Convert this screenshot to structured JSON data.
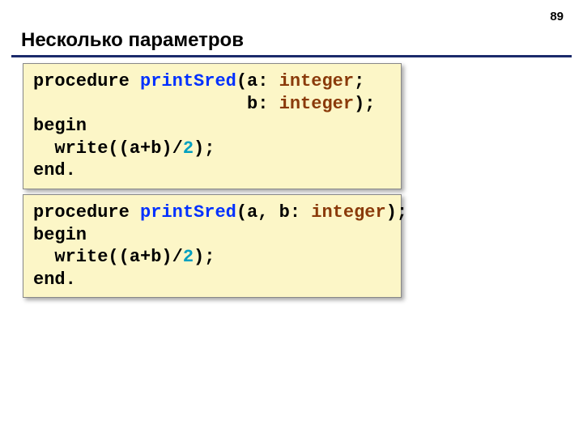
{
  "page_number": "89",
  "title": "Несколько параметров",
  "code1": {
    "t_procedure": "procedure ",
    "t_name": "printSred",
    "t_paren1": "(a: ",
    "t_integer1": "integer",
    "t_semi": ";",
    "t_indent": "                    b: ",
    "t_integer2": "integer",
    "t_close": ");",
    "t_begin": "begin",
    "t_write": "  write((a+b)/",
    "t_two": "2",
    "t_wclose": ");",
    "t_end": "end."
  },
  "code2": {
    "t_procedure": "procedure ",
    "t_name": "printSred",
    "t_paren1": "(a, b: ",
    "t_integer": "integer",
    "t_close": ");",
    "t_begin": "begin",
    "t_write": "  write((a+b)/",
    "t_two": "2",
    "t_wclose": ");",
    "t_end": "end."
  }
}
